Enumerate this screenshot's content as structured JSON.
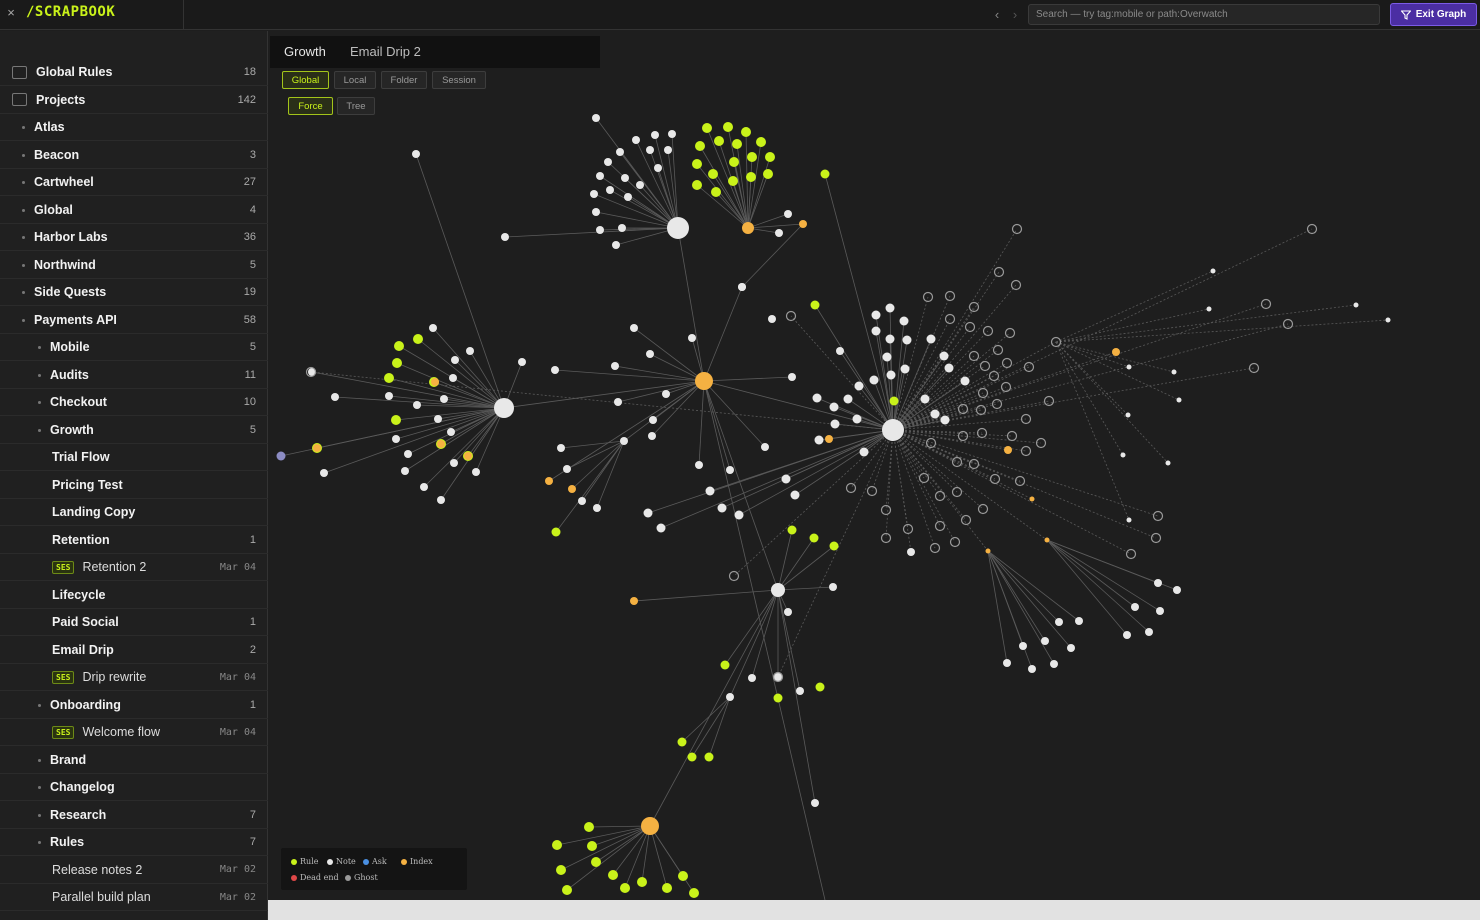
{
  "app": {
    "brand": "∕SCRAPBOOK",
    "close_icon": "×"
  },
  "topbar": {
    "search_placeholder": "Search — try tag:mobile or path:Overwatch",
    "exit_label": "Exit Graph",
    "back_icon": "‹",
    "forward_icon": "›"
  },
  "tabs": [
    {
      "label": "Growth"
    },
    {
      "label": "Email Drip 2"
    }
  ],
  "scope_filters": [
    "Global",
    "Local",
    "Folder",
    "Session"
  ],
  "layout_modes": [
    "Force",
    "Tree"
  ],
  "sidebar": {
    "items": [
      {
        "label": "Global Rules",
        "count": "18"
      },
      {
        "label": "Projects",
        "count": "142"
      },
      {
        "label": "Atlas",
        "count": ""
      },
      {
        "label": "Beacon",
        "count": "3"
      },
      {
        "label": "Cartwheel",
        "count": "27"
      },
      {
        "label": "Global",
        "count": "4"
      },
      {
        "label": "Harbor Labs",
        "count": "36"
      },
      {
        "label": "Northwind",
        "count": "5"
      },
      {
        "label": "Side Quests",
        "count": "19"
      },
      {
        "label": "Payments API",
        "count": "58"
      },
      {
        "label": "Mobile",
        "count": "5"
      },
      {
        "label": "Audits",
        "count": "11"
      },
      {
        "label": "Checkout",
        "count": "10"
      },
      {
        "label": "Growth",
        "count": "5"
      },
      {
        "label": "Trial Flow",
        "count": ""
      },
      {
        "label": "Pricing Test",
        "count": ""
      },
      {
        "label": "Landing Copy",
        "count": ""
      },
      {
        "label": "Retention",
        "count": "1"
      },
      {
        "label": "Retention 2",
        "badge": "SES",
        "date": "Mar 04"
      },
      {
        "label": "Lifecycle",
        "count": ""
      },
      {
        "label": "Paid Social",
        "count": "1"
      },
      {
        "label": "Email Drip",
        "count": "2"
      },
      {
        "label": "Drip rewrite",
        "badge": "SES",
        "date": "Mar 04"
      },
      {
        "label": "Onboarding",
        "count": "1"
      },
      {
        "label": "Welcome flow",
        "badge": "SES",
        "date": "Mar 04"
      },
      {
        "label": "Brand",
        "count": ""
      },
      {
        "label": "Changelog",
        "count": ""
      },
      {
        "label": "Research",
        "count": "7"
      },
      {
        "label": "Rules",
        "count": "7"
      },
      {
        "label": "Release notes 2",
        "date": "Mar 02"
      },
      {
        "label": "Parallel build plan",
        "date": "Mar 02"
      }
    ]
  },
  "legend": [
    {
      "label": "Rule",
      "color": "#c9f21a"
    },
    {
      "label": "Note",
      "color": "#e8e8e8"
    },
    {
      "label": "Ask",
      "color": "#4a90e2"
    },
    {
      "label": "Index",
      "color": "#f5b142"
    },
    {
      "label": "Dead end",
      "color": "#e04848"
    },
    {
      "label": "Ghost",
      "color": "#9a9a9a"
    }
  ],
  "colors": {
    "accent": "#c9f21a",
    "note": "#e8e8e8",
    "index": "#f5b142",
    "ghost": "#9a9a9a",
    "exit_button": "#4b2ea3"
  }
}
